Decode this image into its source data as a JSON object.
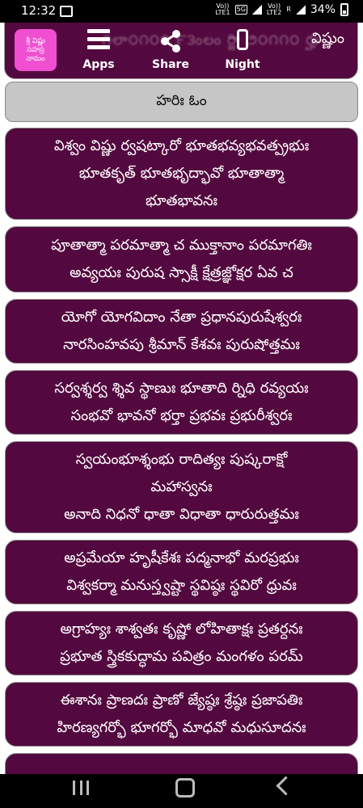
{
  "status": {
    "time": "12:32",
    "net1_top": "Vo))",
    "net1_label": "LTE1",
    "net1_type": "5G",
    "net2_top": "Vo))",
    "net2_label": "LTE2",
    "net2_r": "R",
    "battery": "34%"
  },
  "app": {
    "logo_text": "శ్రీ విష్ణు సహస్ర నామం",
    "apps_label": "Apps",
    "share_label": "Share",
    "night_label": "Night",
    "top_card_tail": "విష్ణుం",
    "top_card_blurred": "౧లా౦౧౦౦ ౯౩ంలం ర్జిా ౨౦౧౧౦ ర్హు"
  },
  "header": "హరిః ఓం",
  "verses": [
    {
      "lines": [
        "విశ్వం విష్ణు ర్వషట్కారో భూతభవ్యభవత్ప్రభుః",
        "భూతకృత్ భూతభృద్భావో భూతాత్మా",
        "భూతభావనః"
      ]
    },
    {
      "lines": [
        "పూతాత్మా పరమాత్మా చ ముక్తానాం పరమాగతిః",
        "అవ్యయః పురుష స్సాక్షీ క్షేత్రజ్ఞోక్షర ఏవ చ"
      ]
    },
    {
      "lines": [
        "యోగో యోగవిదాం నేతా ప్రధానపురుషేశ్వరః",
        "నారసింహవపు శ్రీమాన్ కేశవః పురుషోత్తమః"
      ]
    },
    {
      "lines": [
        "సర్వశ్శర్వ శ్శివ స్థాణుః భూతాది ర్నిధి రవ్యయః",
        "సంభవో భావనో భర్తా ప్రభవః ప్రభురీశ్వరః"
      ]
    },
    {
      "lines": [
        "స్వయంభూశ్శంభు రాదిత్యః పుష్కరాక్షో",
        "మహాస్వనః",
        "అనాది నిధనో ధాతా విధాతా ధారురుత్తమః"
      ]
    },
    {
      "lines": [
        "అప్రమేయా హృషీకేశః పద్మనాభో మరప్రభుః",
        "విశ్వకర్మా మనుస్త్వష్టా స్థవిష్ఠః స్థవిరో ధ్రువః"
      ]
    },
    {
      "lines": [
        "అగ్రాహ్యః శాశ్వతః కృష్ణో లోహితాక్షః ప్రతర్దనః",
        "ప్రభూత స్త్రికకుద్ధామ పవిత్రం మంగళం పరమ్"
      ]
    },
    {
      "lines": [
        "ఈశానః ప్రాణదః ప్రాణో జ్యేష్ఠః శ్రేష్ఠః ప్రజాపతిః",
        "హిరణ్యగర్భో భూగర్భో మాధవో మధుసూదనః"
      ]
    }
  ]
}
